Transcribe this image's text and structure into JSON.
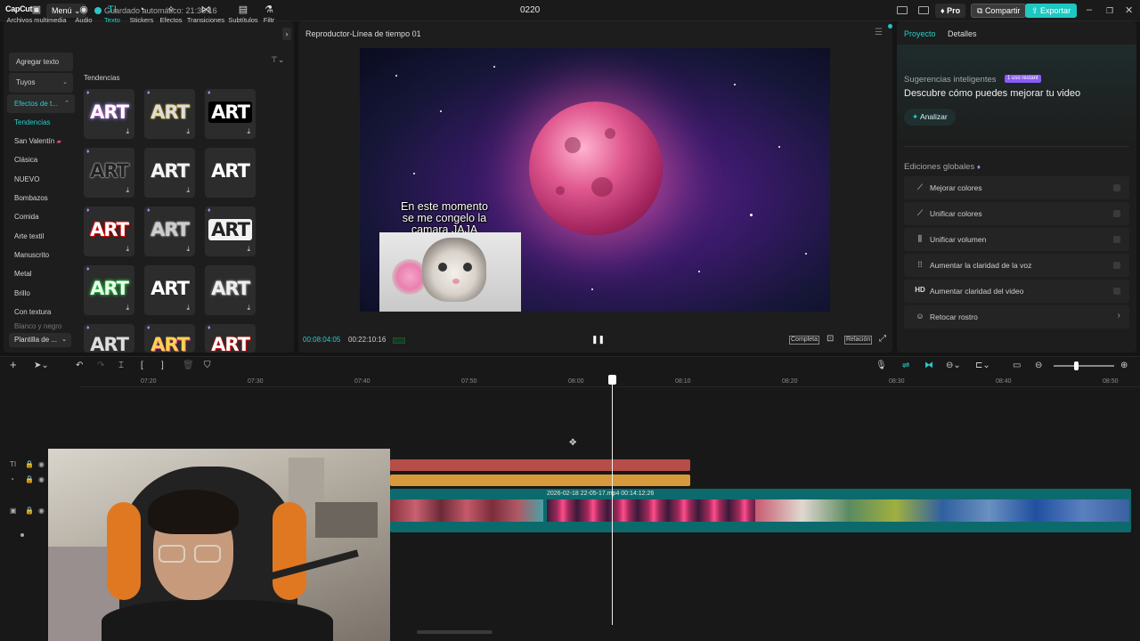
{
  "app": {
    "logo": "CapCut",
    "menu_label": "Menú",
    "autosave": "Guardado automático: 21:36:16",
    "project_name": "0220",
    "pro_label": "Pro",
    "share_label": "Compartir",
    "export_label": "Exportar"
  },
  "media_tabs": [
    {
      "label": "Archivos multimedia",
      "icon": "media-icon"
    },
    {
      "label": "Audio",
      "icon": "audio-icon"
    },
    {
      "label": "Texto",
      "icon": "text-icon"
    },
    {
      "label": "Stickers",
      "icon": "sticker-icon"
    },
    {
      "label": "Efectos",
      "icon": "effects-icon"
    },
    {
      "label": "Transiciones",
      "icon": "transitions-icon"
    },
    {
      "label": "Subtítulos",
      "icon": "subtitles-icon"
    },
    {
      "label": "Filtr",
      "icon": "filters-icon"
    }
  ],
  "sidenav": {
    "add_text": "Agregar texto",
    "tuyos": "Tuyos",
    "efectos": "Efectos de t...",
    "items": [
      "Tendencias",
      "San Valentín",
      "Clásica",
      "NUEVO",
      "Bombazos",
      "Comida",
      "Arte textil",
      "Manuscrito",
      "Metal",
      "Brillo",
      "Con textura",
      "Blanco y negro"
    ],
    "template": "Plantilla de ..."
  },
  "grid": {
    "title": "Tendencias",
    "card_text": "ART"
  },
  "player": {
    "title": "Reproductor-Línea de tiempo 01",
    "caption_line1": "En este momento",
    "caption_line2": "se me congelo la",
    "caption_line3": "camara JAJA",
    "time_current": "00:08:04:05",
    "time_total": "00:22:10:16",
    "full_label": "Completa",
    "ratio_label": "Relación"
  },
  "right_panel": {
    "tab_project": "Proyecto",
    "tab_details": "Detalles",
    "smart_title": "Sugerencias inteligentes",
    "badge": "1 uso restant",
    "smart_desc": "Descubre cómo puedes mejorar tu video",
    "analyze_label": "Analizar",
    "global_title": "Ediciones globales",
    "items": [
      {
        "label": "Mejorar colores",
        "icon": "magic-wand-icon"
      },
      {
        "label": "Unificar colores",
        "icon": "color-match-icon"
      },
      {
        "label": "Unificar volumen",
        "icon": "volume-levels-icon"
      },
      {
        "label": "Aumentar la claridad de la voz",
        "icon": "voice-wave-icon"
      },
      {
        "label": "Aumentar claridad del video",
        "icon": "hd-icon"
      },
      {
        "label": "Retocar rostro",
        "icon": "face-retouch-icon"
      }
    ]
  },
  "timeline": {
    "ruler": [
      "07:20",
      "07:30",
      "07:40",
      "07:50",
      "08:00",
      "08:10",
      "08:20",
      "08:30",
      "08:40",
      "08:50"
    ],
    "clip_label": "2026-02-18 22-05-17.mp4   00:14:12:26"
  },
  "colors": {
    "accent": "#1fc7c1",
    "clip_red": "#b64d48",
    "clip_yellow": "#d6993c",
    "video_track": "#0d6a6c",
    "pro_purple": "#8b5cf6"
  }
}
